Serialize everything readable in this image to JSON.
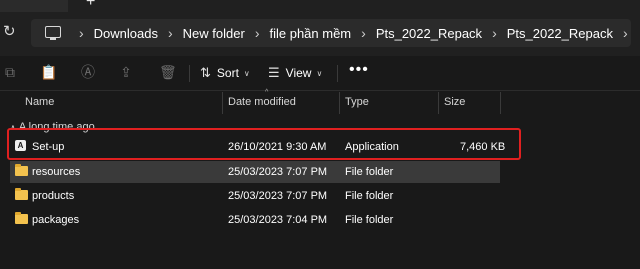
{
  "tabstrip": {
    "new_tab_glyph": "+"
  },
  "address": {
    "refresh_glyph": "↻",
    "crumbs": [
      "Downloads",
      "New folder",
      "file phần mềm",
      "Pts_2022_Repack",
      "Pts_2022_Repack"
    ],
    "separator_glyph": "›"
  },
  "toolbar": {
    "sort_label": "Sort",
    "view_label": "View",
    "more_glyph": "•••"
  },
  "columns": {
    "name": "Name",
    "date": "Date modified",
    "type": "Type",
    "size": "Size"
  },
  "group": {
    "label": "A long time ago"
  },
  "files": [
    {
      "name": "Set-up",
      "date": "26/10/2021 9:30 AM",
      "type": "Application",
      "size": "7,460 KB",
      "icon": "application-icon",
      "selected": false
    },
    {
      "name": "resources",
      "date": "25/03/2023 7:07 PM",
      "type": "File folder",
      "size": "",
      "icon": "folder-icon",
      "selected": true
    },
    {
      "name": "products",
      "date": "25/03/2023 7:07 PM",
      "type": "File folder",
      "size": "",
      "icon": "folder-icon",
      "selected": false
    },
    {
      "name": "packages",
      "date": "25/03/2023 7:04 PM",
      "type": "File folder",
      "size": "",
      "icon": "folder-icon",
      "selected": false
    }
  ],
  "colors": {
    "highlight_box": "#e02020",
    "folder": "#f3c24e",
    "background": "#191919",
    "selected_row": "#3a3a3a"
  }
}
